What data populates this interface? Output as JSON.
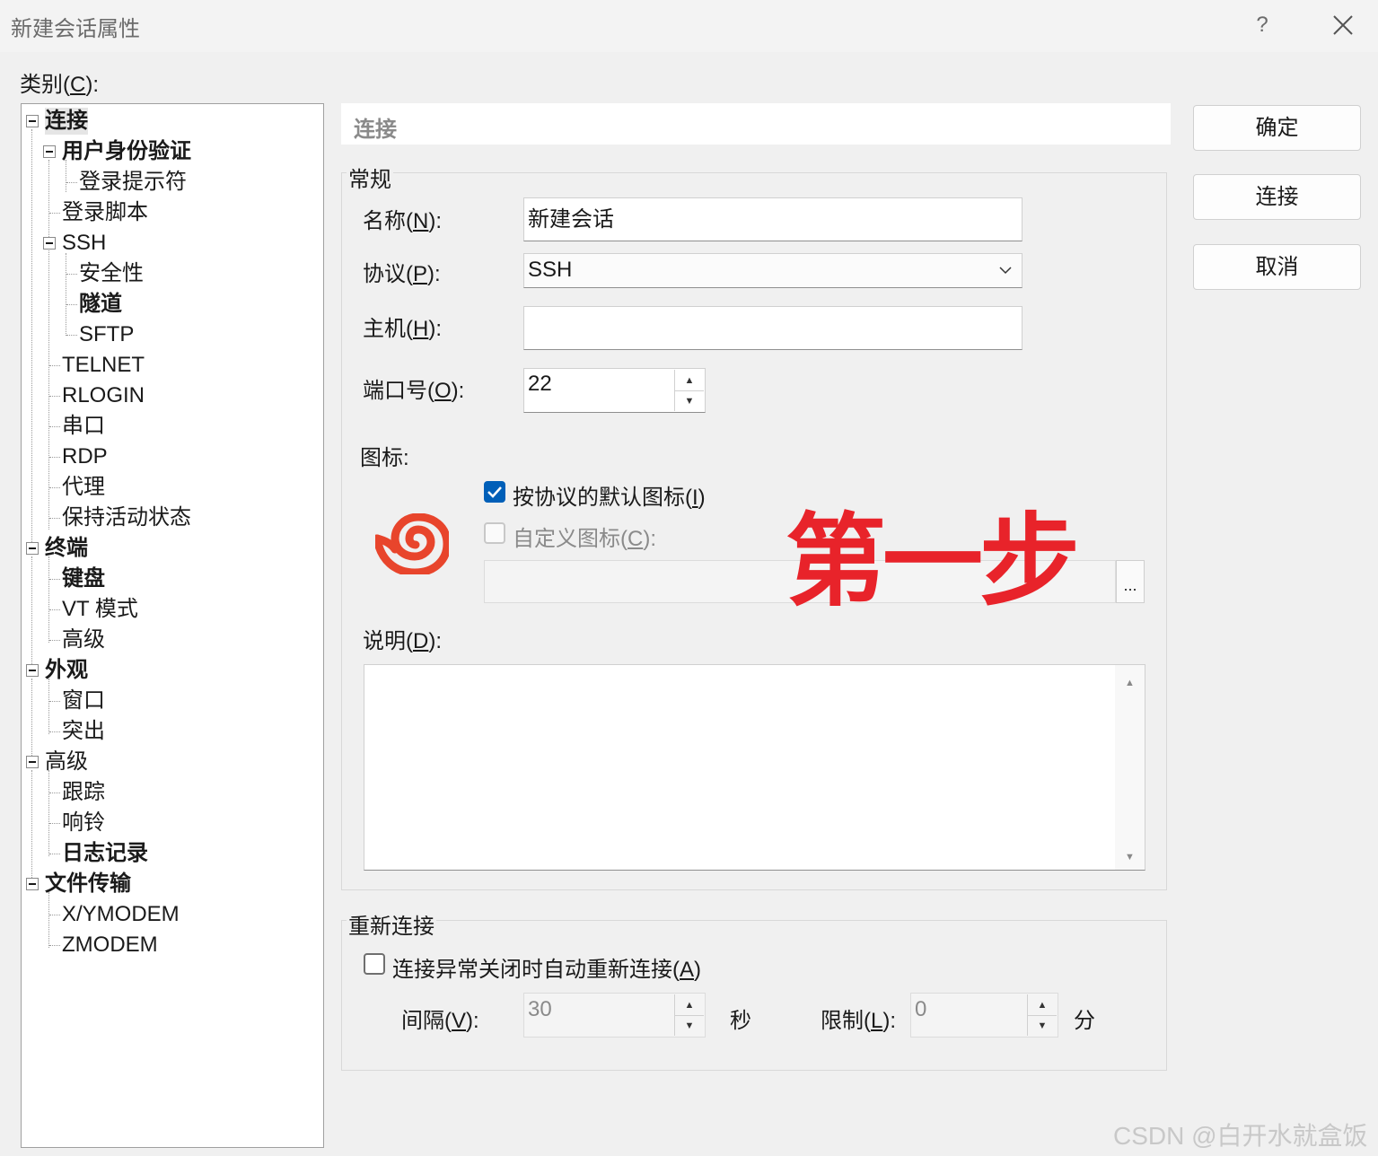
{
  "window": {
    "title": "新建会话属性",
    "help": "?",
    "close_icon": "close-icon"
  },
  "category": {
    "label_pre": "类别(",
    "label_key": "C",
    "label_post": "):"
  },
  "tree": [
    {
      "label": "连接",
      "bold": true,
      "selected": true
    },
    {
      "label": "用户身份验证",
      "bold": true
    },
    {
      "label": "登录提示符",
      "bold": false
    },
    {
      "label": "登录脚本",
      "bold": false
    },
    {
      "label": "SSH",
      "bold": false
    },
    {
      "label": "安全性",
      "bold": false
    },
    {
      "label": "隧道",
      "bold": true
    },
    {
      "label": "SFTP",
      "bold": false
    },
    {
      "label": "TELNET",
      "bold": false
    },
    {
      "label": "RLOGIN",
      "bold": false
    },
    {
      "label": "串口",
      "bold": false
    },
    {
      "label": "RDP",
      "bold": false
    },
    {
      "label": "代理",
      "bold": false
    },
    {
      "label": "保持活动状态",
      "bold": false
    },
    {
      "label": "终端",
      "bold": true
    },
    {
      "label": "键盘",
      "bold": true
    },
    {
      "label": "VT 模式",
      "bold": false
    },
    {
      "label": "高级",
      "bold": false
    },
    {
      "label": "外观",
      "bold": true
    },
    {
      "label": "窗口",
      "bold": false
    },
    {
      "label": "突出",
      "bold": false
    },
    {
      "label": "高级",
      "bold": false
    },
    {
      "label": "跟踪",
      "bold": false
    },
    {
      "label": "响铃",
      "bold": false
    },
    {
      "label": "日志记录",
      "bold": true
    },
    {
      "label": "文件传输",
      "bold": true
    },
    {
      "label": "X/YMODEM",
      "bold": false
    },
    {
      "label": "ZMODEM",
      "bold": false
    }
  ],
  "panel": {
    "header": "连接",
    "general": {
      "title": "常规",
      "name": {
        "pre": "名称(",
        "key": "N",
        "post": "):",
        "value": "新建会话"
      },
      "protocol": {
        "pre": "协议(",
        "key": "P",
        "post": "):",
        "value": "SSH"
      },
      "host": {
        "pre": "主机(",
        "key": "H",
        "post": "):",
        "value": ""
      },
      "port": {
        "pre": "端口号(",
        "key": "O",
        "post": "):",
        "value": "22"
      },
      "icon_label": "图标:",
      "default_icon": {
        "pre": "按协议的默认图标(",
        "key": "I",
        "post": ")",
        "checked": true
      },
      "custom_icon": {
        "pre": "自定义图标(",
        "key": "C",
        "post": "):",
        "checked": false
      },
      "browse": "...",
      "desc": {
        "pre": "说明(",
        "key": "D",
        "post": "):",
        "value": ""
      }
    },
    "reconnect": {
      "title": "重新连接",
      "auto": {
        "pre": "连接异常关闭时自动重新连接(",
        "key": "A",
        "post": ")",
        "checked": false
      },
      "interval": {
        "pre": "间隔(",
        "key": "V",
        "post": "):",
        "value": "30",
        "unit": "秒"
      },
      "limit": {
        "pre": "限制(",
        "key": "L",
        "post": "):",
        "value": "0",
        "unit": "分"
      }
    }
  },
  "buttons": {
    "ok": "确定",
    "connect": "连接",
    "cancel": "取消"
  },
  "annotation": {
    "text": "第一步",
    "color": "#e8232a"
  },
  "watermark": "CSDN @白开水就盒饭",
  "colors": {
    "accent": "#005fb8",
    "icon": "#e8452c"
  }
}
